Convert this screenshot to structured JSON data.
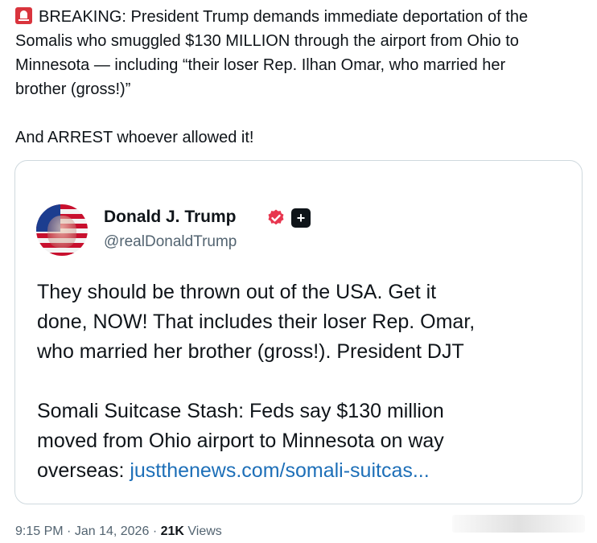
{
  "tweet": {
    "icon": "police-siren-icon",
    "line1": "BREAKING: President Trump demands immediate deportation of the",
    "line2": "Somalis who smuggled $130 MILLION through the airport from Ohio to",
    "line3": "Minnesota — including “their loser Rep. Ilhan Omar, who married her",
    "line4": "brother (gross!)”",
    "line5": "And ARREST whoever allowed it!"
  },
  "quoted": {
    "display_name": "Donald J. Trump",
    "handle": "@realDonaldTrump",
    "verified_color": "#e8364f",
    "body_line1": "They should be thrown out of the USA. Get it",
    "body_line2": "done, NOW! That includes their loser Rep. Omar,",
    "body_line3": "who married her brother (gross!). President DJT",
    "body_line4": "Somali Suitcase Stash: Feds say $130 million",
    "body_line5": "moved from Ohio airport to Minnesota on way",
    "body_line6_prefix": "overseas: ",
    "link_text": "justthenews.com/somali-suitcas..."
  },
  "meta": {
    "time": "9:15 PM",
    "separator": "·",
    "date": "Jan 14, 2026",
    "views_count": "21K",
    "views_label": "Views"
  },
  "colors": {
    "link": "#1d6fb8",
    "secondary_text": "#536471",
    "border": "#cfd9de"
  }
}
